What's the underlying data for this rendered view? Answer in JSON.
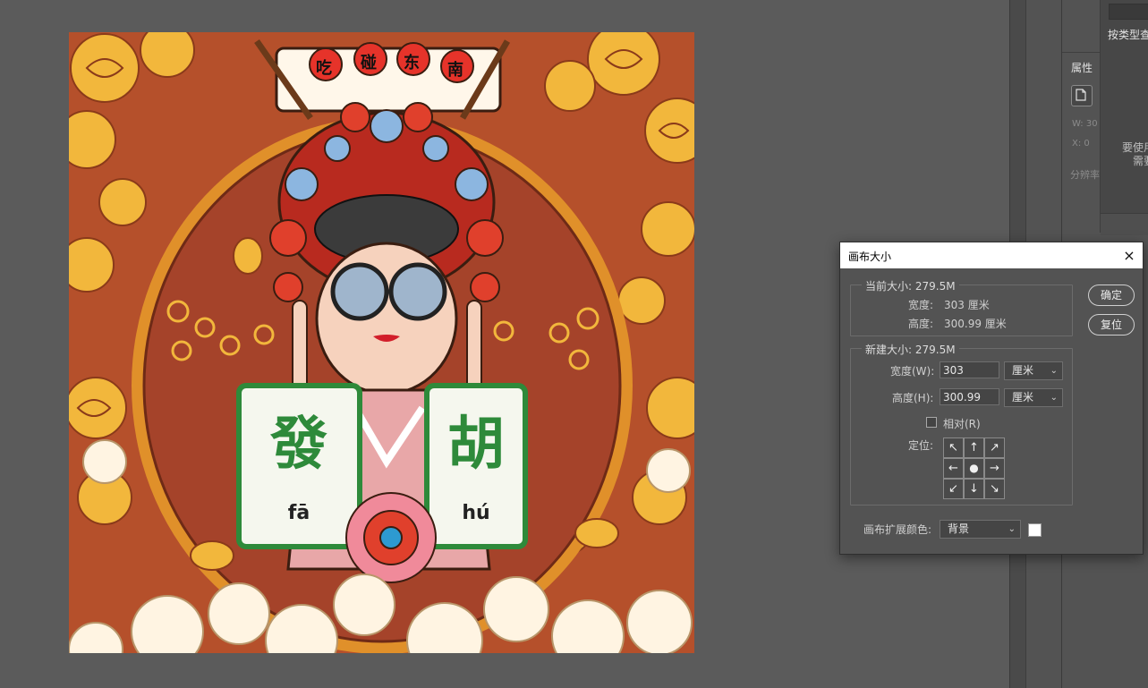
{
  "artwork": {
    "banner_chars": [
      "吃",
      "碰",
      "东",
      "南"
    ],
    "tile_left_char": "發",
    "tile_left_pinyin": "fā",
    "tile_right_char": "胡",
    "tile_right_pinyin": "hú",
    "colors": {
      "background": "#b5502b",
      "cloud_gold": "#f2b73c",
      "medallion": "#a5432a",
      "tile_green": "#2e8a3a"
    }
  },
  "panels": {
    "properties_title": "属性",
    "w_label": "W:  30",
    "x_label": "X:  0",
    "resolution_label": "分辨率",
    "libraries_filter": "按类型查",
    "libraries_msg_line1": "要使用",
    "libraries_msg_line2": "需要"
  },
  "dialog": {
    "title": "画布大小",
    "close_icon": "×",
    "current_size": {
      "label": "当前大小: 279.5M",
      "width_label": "宽度:",
      "width_value": "303 厘米",
      "height_label": "高度:",
      "height_value": "300.99 厘米"
    },
    "new_size": {
      "label": "新建大小: 279.5M",
      "width_label": "宽度(W):",
      "width_value": "303",
      "width_unit": "厘米",
      "height_label": "高度(H):",
      "height_value": "300.99",
      "height_unit": "厘米",
      "relative_label": "相对(R)",
      "relative_checked": false,
      "anchor_label": "定位:",
      "anchor_arrows": [
        "↖",
        "↑",
        "↗",
        "←",
        "●",
        "→",
        "↙",
        "↓",
        "↘"
      ]
    },
    "extension_color_label": "画布扩展颜色:",
    "extension_color_value": "背景",
    "extension_swatch_color": "#ffffff",
    "ok_button": "确定",
    "reset_button": "复位"
  }
}
